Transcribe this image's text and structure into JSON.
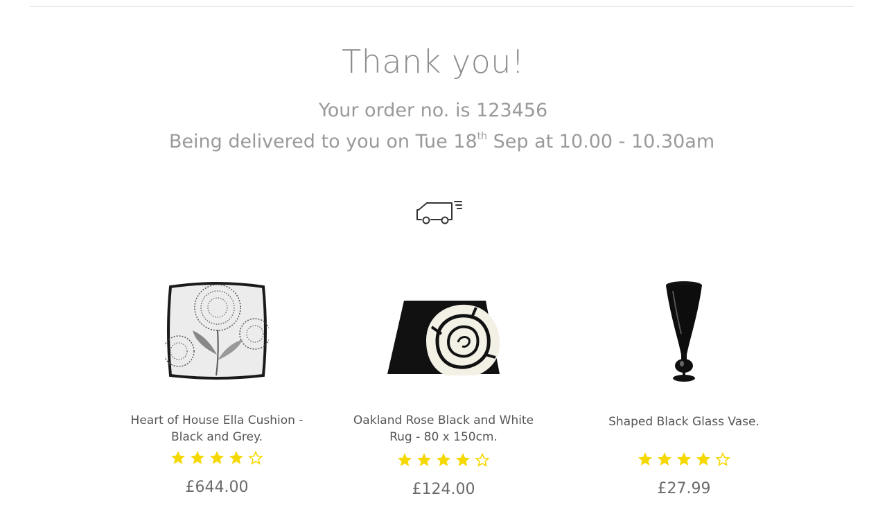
{
  "header": {
    "title": "Thank you!",
    "order_text": "Your order no. is 123456",
    "delivery_prefix": "Being delivered to you on Tue 18",
    "delivery_suffix_sup": "th",
    "delivery_rest": " Sep at 10.00 - 10.30am"
  },
  "icons": {
    "truck": "delivery-truck-icon",
    "star": "star-icon"
  },
  "colors": {
    "star_fill": "#f5d800",
    "text": "#8e8e8e"
  },
  "products": [
    {
      "name": "Heart of House Ella Cushion - Black and Grey.",
      "price": "£644.00",
      "rating": 4,
      "rating_max": 5
    },
    {
      "name": "Oakland Rose Black and White Rug - 80 x 150cm.",
      "price": "£124.00",
      "rating": 4,
      "rating_max": 5
    },
    {
      "name": "Shaped Black Glass Vase.",
      "price": "£27.99",
      "rating": 4,
      "rating_max": 5
    }
  ]
}
